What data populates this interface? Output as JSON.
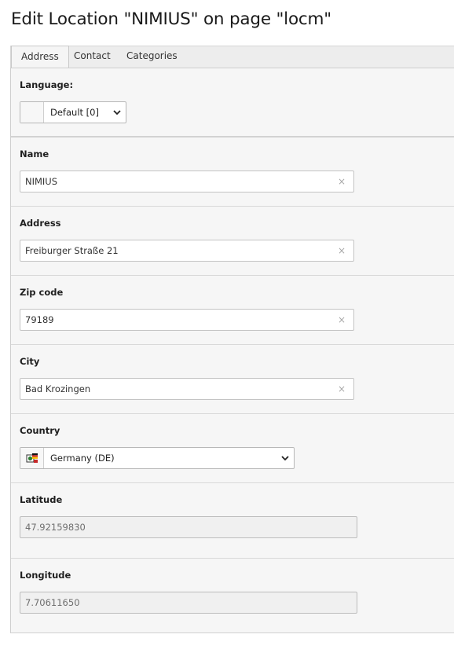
{
  "page": {
    "title": "Edit Location \"NIMIUS\" on page \"locm\""
  },
  "tabs": [
    {
      "label": "Address",
      "active": true
    },
    {
      "label": "Contact",
      "active": false
    },
    {
      "label": "Categories",
      "active": false
    }
  ],
  "language": {
    "label": "Language:",
    "value": "Default [0]"
  },
  "fields": {
    "name": {
      "label": "Name",
      "value": "NIMIUS"
    },
    "address": {
      "label": "Address",
      "value": "Freiburger Straße 21"
    },
    "zip": {
      "label": "Zip code",
      "value": "79189"
    },
    "city": {
      "label": "City",
      "value": "Bad Krozingen"
    },
    "country": {
      "label": "Country",
      "value": "Germany (DE)",
      "icon": "country-flag-icon"
    },
    "latitude": {
      "label": "Latitude",
      "value": "47.92159830"
    },
    "longitude": {
      "label": "Longitude",
      "value": "7.70611650"
    }
  },
  "icons": {
    "clear": "×"
  },
  "colors": {
    "panel_bg": "#f6f6f6",
    "tab_bar_bg": "#ededed",
    "readonly_bg": "#f0f0f0"
  }
}
